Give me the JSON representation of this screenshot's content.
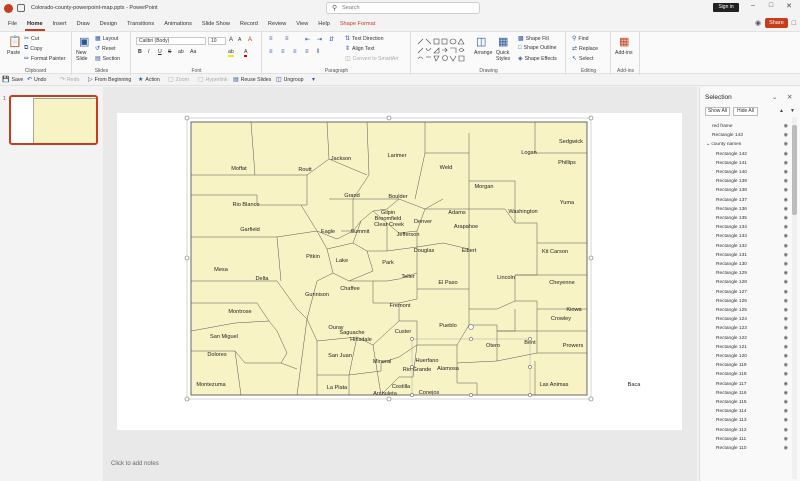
{
  "window": {
    "title": "Colorado-county-powerpoint-map.pptx  -  PowerPoint",
    "search_placeholder": "Search",
    "signin": "Sign in"
  },
  "tabs": [
    "File",
    "Home",
    "Insert",
    "Draw",
    "Design",
    "Transitions",
    "Animations",
    "Slide Show",
    "Record",
    "Review",
    "View",
    "Help",
    "Shape Format"
  ],
  "active_tab": "Home",
  "share_label": "Share",
  "ribbon": {
    "clipboard": {
      "label": "Clipboard",
      "paste": "Paste",
      "cut": "Cut",
      "copy": "Copy",
      "format_painter": "Format Painter"
    },
    "slides": {
      "label": "Slides",
      "new_slide": "New Slide",
      "layout": "Layout",
      "reset": "Reset",
      "section": "Section"
    },
    "font": {
      "label": "Font",
      "font_name": "Calibri (Body)",
      "font_size": "10",
      "bold": "B",
      "italic": "I",
      "underline": "U",
      "strike": "S",
      "spacing": "ab",
      "grow": "A",
      "shrink": "A",
      "clear": "A",
      "case": "Aa",
      "highlight": "ab",
      "color": "A"
    },
    "paragraph": {
      "label": "Paragraph",
      "text_direction": "Text Direction",
      "align_text": "Align Text",
      "convert_smartart": "Convert to SmartArt"
    },
    "drawing": {
      "label": "Drawing",
      "arrange": "Arrange",
      "quick_styles": "Quick Styles",
      "shape_fill": "Shape Fill",
      "shape_outline": "Shape Outline",
      "shape_effects": "Shape Effects"
    },
    "editing": {
      "label": "Editing",
      "find": "Find",
      "replace": "Replace",
      "select": "Select"
    },
    "addins": {
      "label": "Add-ins",
      "addins": "Add-ins"
    }
  },
  "qat": {
    "save": "Save",
    "undo": "Undo",
    "redo": "Redo",
    "from_beginning": "From Beginning",
    "action": "Action",
    "item6": "Zoom",
    "item7": "Hyperlink",
    "reuse_slides": "Reuse Slides",
    "ungroup": "Ungroup"
  },
  "thumbnail": {
    "number": "1"
  },
  "notes_placeholder": "Click to add notes",
  "map": {
    "fill": "#f8f3c4",
    "stroke": "#555555",
    "counties": [
      {
        "name": "Moffat"
      },
      {
        "name": "Jackson"
      },
      {
        "name": "Larimer"
      },
      {
        "name": "Logan"
      },
      {
        "name": "Sedgwick"
      },
      {
        "name": "Phillips"
      },
      {
        "name": "Routt"
      },
      {
        "name": "Weld"
      },
      {
        "name": "Morgan"
      },
      {
        "name": "Yuma"
      },
      {
        "name": "Rio Blanco"
      },
      {
        "name": "Grand"
      },
      {
        "name": "Boulder"
      },
      {
        "name": "Gilpin"
      },
      {
        "name": "Broomfield"
      },
      {
        "name": "Adams"
      },
      {
        "name": "Washington"
      },
      {
        "name": "Garfield"
      },
      {
        "name": "Eagle"
      },
      {
        "name": "Summit"
      },
      {
        "name": "Clear Creek"
      },
      {
        "name": "Denver"
      },
      {
        "name": "Arapahoe"
      },
      {
        "name": "Jefferson"
      },
      {
        "name": "Douglas"
      },
      {
        "name": "Elbert"
      },
      {
        "name": "Kit Carson"
      },
      {
        "name": "Mesa"
      },
      {
        "name": "Pitkin"
      },
      {
        "name": "Lake"
      },
      {
        "name": "Park"
      },
      {
        "name": "Delta"
      },
      {
        "name": "Teller"
      },
      {
        "name": "Lincoln"
      },
      {
        "name": "Cheyenne"
      },
      {
        "name": "Chaffee"
      },
      {
        "name": "Gunnison"
      },
      {
        "name": "El Paso"
      },
      {
        "name": "Fremont"
      },
      {
        "name": "Montrose"
      },
      {
        "name": "Kiowa"
      },
      {
        "name": "Ouray"
      },
      {
        "name": "Crowley"
      },
      {
        "name": "San Miguel"
      },
      {
        "name": "Saguache"
      },
      {
        "name": "Custer"
      },
      {
        "name": "Pueblo"
      },
      {
        "name": "Hinsdale"
      },
      {
        "name": "Otero"
      },
      {
        "name": "Bent"
      },
      {
        "name": "Prowers"
      },
      {
        "name": "Dolores"
      },
      {
        "name": "San Juan"
      },
      {
        "name": "Mineral"
      },
      {
        "name": "Huerfano"
      },
      {
        "name": "Rio Grande"
      },
      {
        "name": "Alamosa"
      },
      {
        "name": "Montezuma"
      },
      {
        "name": "La Plata"
      },
      {
        "name": "Las Animas"
      },
      {
        "name": "Baca"
      },
      {
        "name": "Costilla"
      },
      {
        "name": "Archuleta"
      },
      {
        "name": "Conejos"
      }
    ]
  },
  "selection_pane": {
    "title": "Selection",
    "show_all": "Show All",
    "hide_all": "Hide All",
    "items": [
      "red frame",
      "Rectangle 143",
      "county names",
      "Rectangle 142",
      "Rectangle 141",
      "Rectangle 140",
      "Rectangle 139",
      "Rectangle 138",
      "Rectangle 137",
      "Rectangle 136",
      "Rectangle 135",
      "Rectangle 134",
      "Rectangle 133",
      "Rectangle 132",
      "Rectangle 131",
      "Rectangle 130",
      "Rectangle 129",
      "Rectangle 128",
      "Rectangle 127",
      "Rectangle 126",
      "Rectangle 125",
      "Rectangle 124",
      "Rectangle 123",
      "Rectangle 122",
      "Rectangle 121",
      "Rectangle 120",
      "Rectangle 119",
      "Rectangle 118",
      "Rectangle 117",
      "Rectangle 116",
      "Rectangle 115",
      "Rectangle 114",
      "Rectangle 113",
      "Rectangle 112",
      "Rectangle 111",
      "Rectangle 110"
    ]
  }
}
